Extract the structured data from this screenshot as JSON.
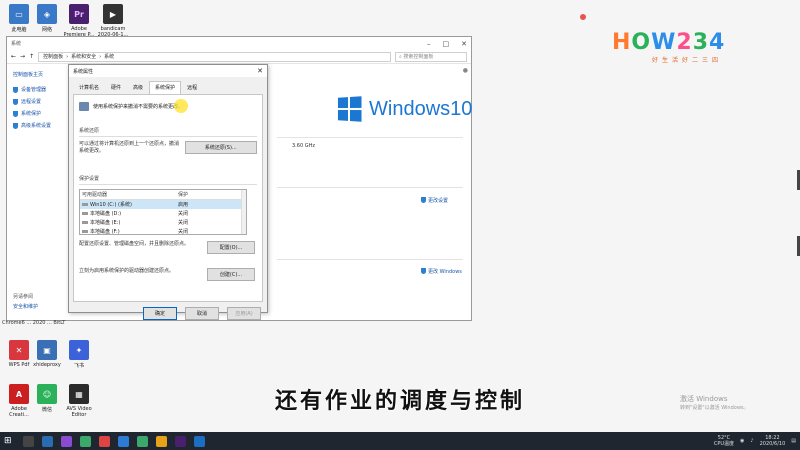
{
  "desktop_icons_top": [
    {
      "label": "此电脑",
      "color": "#3a78c8",
      "glyph": "▭"
    },
    {
      "label": "网络",
      "color": "#3a78c8",
      "glyph": "◈"
    },
    {
      "label": "Adobe Premiere P... 2020 (64 ...",
      "color": "#4a1f6e",
      "glyph": "Pr"
    },
    {
      "label": "bandicam 2020-06-1...",
      "color": "#333",
      "glyph": "▶"
    }
  ],
  "desktop_icons_mid_label": "Chrome6 ... 2020 ... BitLT",
  "desktop_icons_bottom": [
    {
      "label": "WPS Pdf",
      "color": "#d9363e",
      "glyph": "✕"
    },
    {
      "label": "xhideproxy",
      "color": "#3a6fb6",
      "glyph": "▣"
    },
    {
      "label": "飞书",
      "color": "#3b62d8",
      "glyph": "✦"
    },
    {
      "label": "Adobe Creati...",
      "color": "#cc1f1f",
      "glyph": "A"
    },
    {
      "label": "微信",
      "color": "#2bb15a",
      "glyph": "☺"
    },
    {
      "label": "AVS Video Editor",
      "color": "#2a2a2a",
      "glyph": "▦"
    }
  ],
  "logo": {
    "main": "HOW234",
    "sub": "好生活好二三四"
  },
  "system_window": {
    "title": "系统",
    "breadcrumb": [
      "控制面板",
      "系统和安全",
      "系统"
    ],
    "search_placeholder": "搜索控制面板",
    "left_home": "控制面板主页",
    "left_links": [
      "设备管理器",
      "远程设置",
      "系统保护",
      "高级系统设置"
    ],
    "see_also": "另请参阅",
    "see_also_link": "安全和维护",
    "windows_brand": "Windows10",
    "cpu_speed": "3.60 GHz",
    "change_settings": "更改设置",
    "activate_link": "更改 Windows"
  },
  "dialog": {
    "title": "系统属性",
    "tabs": [
      "计算机名",
      "硬件",
      "高级",
      "系统保护",
      "远程"
    ],
    "active_tab": 3,
    "intro": "使用系统保护来撤消不需要的系统更改。",
    "restore_section": "系统还原",
    "restore_text": "可以通过将计算机还原到上一个还原点，撤消系统更改。",
    "restore_button": "系统还原(S)...",
    "protection_section": "保护设置",
    "list_headers": [
      "可用驱动器",
      "保护"
    ],
    "drives": [
      {
        "name": "Win10 (C:) (系统)",
        "status": "启用",
        "selected": true
      },
      {
        "name": "本地磁盘 (D:)",
        "status": "关闭",
        "selected": false
      },
      {
        "name": "本地磁盘 (E:)",
        "status": "关闭",
        "selected": false
      },
      {
        "name": "本地磁盘 (F:)",
        "status": "关闭",
        "selected": false
      }
    ],
    "configure_text": "配置还原设置、管理磁盘空间，并且删除还原点。",
    "configure_button": "配置(O)...",
    "create_text": "立刻为启用系统保护的驱动器创建还原点。",
    "create_button": "创建(C)...",
    "ok": "确定",
    "cancel": "取消",
    "apply": "应用(A)"
  },
  "subtitle": "还有作业的调度与控制",
  "activate_windows": {
    "line1": "激活 Windows",
    "line2": "转到\"设置\"以激活 Windows。"
  },
  "taskbar": {
    "apps": [
      "#e8e8e8",
      "#2b6cb0",
      "#8a4bd1",
      "#3ca86b",
      "#d44",
      "#2e7bd6",
      "#3ca86b",
      "#e8a21a",
      "#4a1f6e",
      "#1b6ec2"
    ],
    "weather": "52°C",
    "weather_label": "CPU温度",
    "time": "18:22",
    "date": "2020/6/10"
  }
}
